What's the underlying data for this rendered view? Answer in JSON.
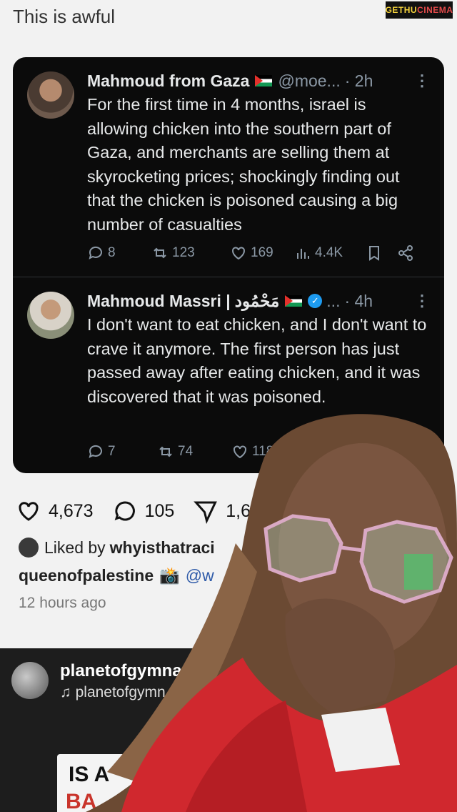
{
  "caption": "This is awful",
  "watermark": {
    "part1": "GETHU",
    "part2": "CINEMA"
  },
  "tweets": [
    {
      "name": "Mahmoud from Gaza",
      "handle": "@moe...",
      "time": "· 2h",
      "text": "For the first time in 4 months, israel is allowing chicken into the southern part of Gaza, and merchants are selling them at skyrocketing prices; shockingly finding out that the chicken is poisoned causing a big number of casualties",
      "replies": "8",
      "reposts": "123",
      "likes": "169",
      "views": "4.4K"
    },
    {
      "name": "Mahmoud Massri |",
      "name_arabic": "مَحْمُود",
      "handle": "...",
      "time": "· 4h",
      "text": "I don't want to eat chicken, and I don't want to crave it anymore. The first person has just passed away after eating chicken, and it was discovered that it was poisoned.",
      "replies": "7",
      "reposts": "74",
      "likes": "118"
    }
  ],
  "post": {
    "likes": "4,673",
    "comments": "105",
    "shares": "1,69",
    "liked_by_label": "Liked by",
    "liked_by_user": "whyisthatraci",
    "author": "queenofpalestine",
    "author_emoji": "📸",
    "mention": "@w",
    "time_ago": "12 hours ago"
  },
  "reel": {
    "username": "planetofgymnasti",
    "audio_icon": "♫",
    "audio": "planetofgymn",
    "poster_line1": "IS A",
    "poster_line2": "BA"
  },
  "colors": {
    "card_bg": "#0b0b0b",
    "muted": "#8b98a5",
    "verified": "#1d9bf0",
    "sweater": "#d0282e"
  },
  "icons": [
    "reply-icon",
    "repost-icon",
    "like-icon",
    "views-icon",
    "bookmark-icon",
    "share-icon",
    "heart-icon",
    "comment-icon",
    "send-icon",
    "music-icon",
    "camera-icon"
  ]
}
